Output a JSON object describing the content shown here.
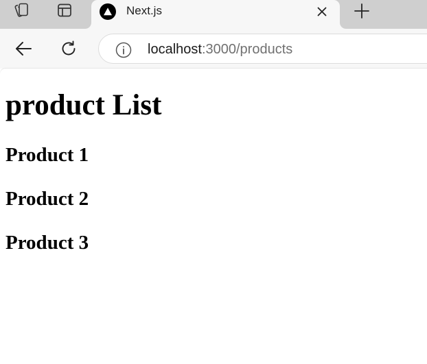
{
  "tabstrip": {
    "workspaces_icon": "workspaces-icon",
    "vertical_tabs_icon": "vertical-tabs-icon",
    "active_tab": {
      "title": "Next.js",
      "favicon": "nextjs-logo-icon",
      "close_icon": "close-icon"
    },
    "new_tab_icon": "plus-icon"
  },
  "toolbar": {
    "back_icon": "arrow-left-icon",
    "refresh_icon": "refresh-icon",
    "address": {
      "info_icon": "info-icon",
      "host": "localhost",
      "path": ":3000/products"
    }
  },
  "page": {
    "heading": "product List",
    "products": [
      {
        "name": "Product 1"
      },
      {
        "name": "Product 2"
      },
      {
        "name": "Product 3"
      }
    ]
  },
  "colors": {
    "tabstrip_bg": "#cfcfcf",
    "toolbar_bg": "#f7f7f7",
    "url_path": "#707070",
    "text": "#000000"
  }
}
